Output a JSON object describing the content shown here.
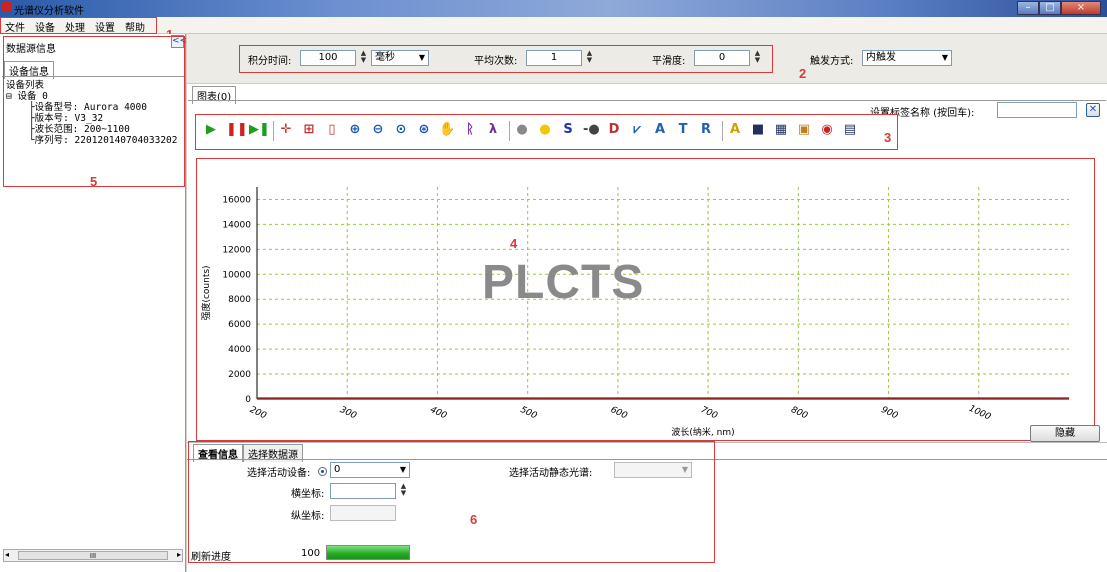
{
  "window": {
    "title": "光谱仪分析软件",
    "controls": [
      "–",
      "□",
      "×"
    ]
  },
  "menu": [
    "文件",
    "设备",
    "处理",
    "设置",
    "帮助"
  ],
  "annotations": {
    "menu": "1",
    "controls": "2",
    "toolbar": "3",
    "chart": "4",
    "devices": "5",
    "info": "6"
  },
  "left_panel": {
    "title": "数据源信息",
    "collapse": "<<",
    "tab": "设备信息",
    "tree_header": "设备列表",
    "device": "⊟ 设备 0",
    "items": [
      "设备型号: Aurora 4000",
      "版本号: V3_32",
      "波长范围: 200~1100",
      "序列号: 220120140704033202"
    ],
    "scroll_mid": "III"
  },
  "controls": {
    "integration_label": "积分时间:",
    "integration_value": "100",
    "integration_unit": "毫秒",
    "average_label": "平均次数:",
    "average_value": "1",
    "smooth_label": "平滑度:",
    "smooth_value": "0",
    "trigger_label": "触发方式:",
    "trigger_value": "内触发"
  },
  "chart_tab": "图表(0)",
  "tag_name_label": "设置标签名称 (按回车):",
  "tag_name_value": "",
  "toolbar_icons": [
    {
      "name": "play-icon",
      "glyph": "▶",
      "color": "#1aa01a"
    },
    {
      "name": "pause-icon",
      "glyph": "❚❚",
      "color": "#d02020"
    },
    {
      "name": "step-icon",
      "glyph": "▶❚",
      "color": "#1aa01a"
    },
    {
      "name": "crosshair-icon",
      "glyph": "✛",
      "color": "#c03030"
    },
    {
      "name": "grid-icon",
      "glyph": "⊞",
      "color": "#c03030"
    },
    {
      "name": "column-icon",
      "glyph": "▯",
      "color": "#c03030"
    },
    {
      "name": "zoom-in-icon",
      "glyph": "⊕",
      "color": "#1a5ab0"
    },
    {
      "name": "zoom-out-icon",
      "glyph": "⊖",
      "color": "#1a5ab0"
    },
    {
      "name": "zoom-fit-icon",
      "glyph": "⊙",
      "color": "#1a5ab0"
    },
    {
      "name": "zoom-set-icon",
      "glyph": "⊛",
      "color": "#1a5ab0"
    },
    {
      "name": "pan-hand-icon",
      "glyph": "✋",
      "color": "#333"
    },
    {
      "name": "peak-marker-icon",
      "glyph": "ᚱ",
      "color": "#7030a0"
    },
    {
      "name": "peak-search-icon",
      "glyph": "λ",
      "color": "#7030a0"
    },
    {
      "name": "bulb-off-icon",
      "glyph": "●",
      "color": "#888"
    },
    {
      "name": "bulb-on-icon",
      "glyph": "●",
      "color": "#f0c800"
    },
    {
      "name": "s-curve-icon",
      "glyph": "S",
      "color": "#1a3aa0"
    },
    {
      "name": "dark-icon",
      "glyph": "-●",
      "color": "#444"
    },
    {
      "name": "dark-subtract-icon",
      "glyph": "D",
      "color": "#c03030"
    },
    {
      "name": "spectrum-chart-icon",
      "glyph": "⩗",
      "color": "#2060b0"
    },
    {
      "name": "absorbance-icon",
      "glyph": "A",
      "color": "#2060b0"
    },
    {
      "name": "transmission-icon",
      "glyph": "T",
      "color": "#2060b0"
    },
    {
      "name": "reflectance-icon",
      "glyph": "R",
      "color": "#2060b0"
    },
    {
      "name": "color-icon",
      "glyph": "A",
      "color": "#d0a000"
    },
    {
      "name": "save-icon",
      "glyph": "■",
      "color": "#203060"
    },
    {
      "name": "save-all-icon",
      "glyph": "▦",
      "color": "#203060"
    },
    {
      "name": "export-image-icon",
      "glyph": "▣",
      "color": "#c08020"
    },
    {
      "name": "close-data-icon",
      "glyph": "◉",
      "color": "#d02020"
    },
    {
      "name": "print-icon",
      "glyph": "▤",
      "color": "#203060"
    }
  ],
  "chart_data": {
    "type": "line",
    "xlabel": "波长(纳米, nm)",
    "ylabel": "强度(counts)",
    "x_ticks": [
      "200",
      "300",
      "400",
      "500",
      "600",
      "700",
      "800",
      "900",
      "1000"
    ],
    "y_ticks": [
      "0",
      "2000",
      "4000",
      "6000",
      "8000",
      "10000",
      "12000",
      "14000",
      "16000"
    ],
    "xlim": [
      200,
      1100
    ],
    "ylim": [
      0,
      17000
    ],
    "grid": true,
    "series": [
      {
        "color": "#c03030",
        "x": [
          200,
          1100
        ],
        "y": [
          0,
          0
        ]
      }
    ]
  },
  "watermark": "PLCTS",
  "hide_button": "隐藏",
  "bottom": {
    "tabs": [
      "查看信息",
      "选择数据源"
    ],
    "active_device_label": "选择活动设备:",
    "active_device_value": "0",
    "static_spectrum_label": "选择活动静态光谱:",
    "abscissa_label": "横坐标:",
    "ordinate_label": "纵坐标:",
    "refresh_label": "刷新进度",
    "refresh_value": "100"
  }
}
